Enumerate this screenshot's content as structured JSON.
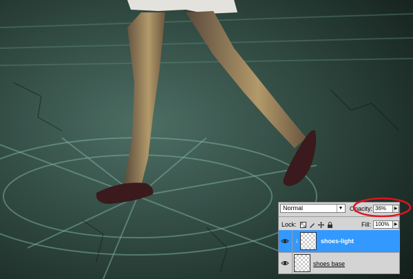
{
  "layers_panel": {
    "blend_mode": "Normal",
    "opacity_label": "Opacity:",
    "opacity_value": "36%",
    "lock_label": "Lock:",
    "fill_label": "Fill:",
    "fill_value": "100%",
    "layers": [
      {
        "name": "shoes-light",
        "selected": true,
        "visible": true
      },
      {
        "name": "shoes base",
        "selected": false,
        "visible": true
      }
    ]
  },
  "colors": {
    "selection": "#3399ff",
    "annotation": "#e0141e",
    "panel_bg": "#d4d4d4"
  }
}
